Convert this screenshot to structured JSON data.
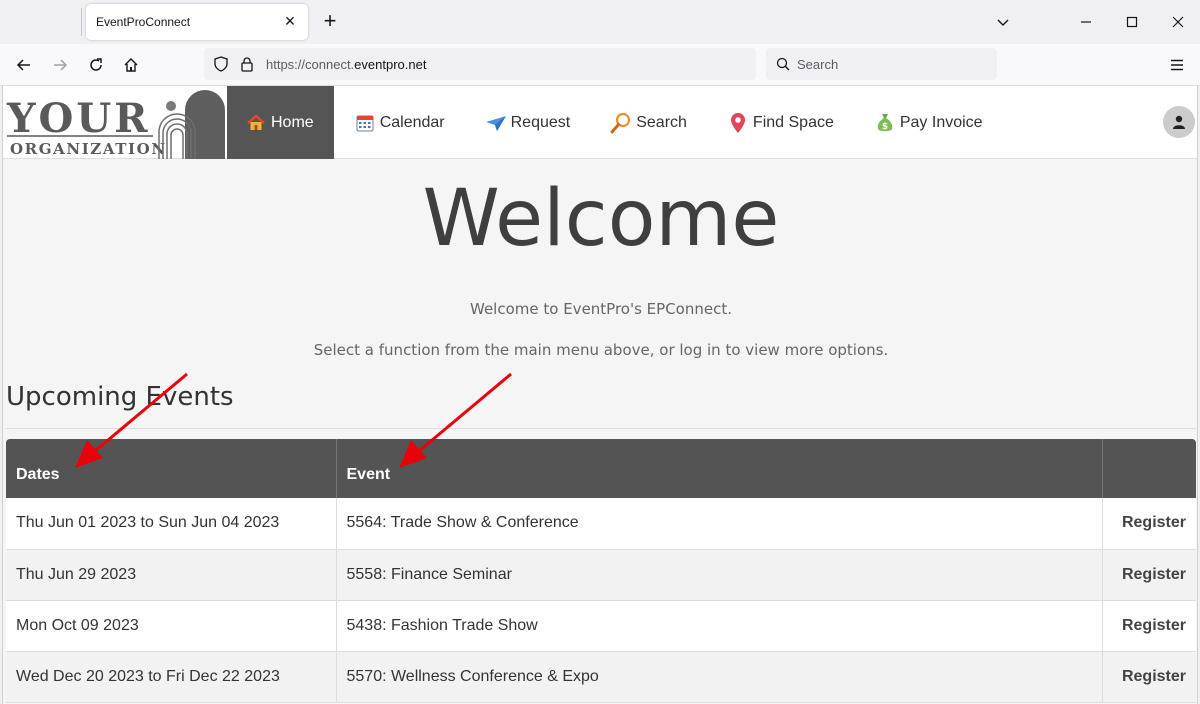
{
  "browser": {
    "tab_title": "EventProConnect",
    "url_prefix": "https://connect.",
    "url_host": "eventpro.net",
    "search_placeholder": "Search"
  },
  "menu": {
    "items": [
      {
        "label": "Home",
        "icon": "house-icon"
      },
      {
        "label": "Calendar",
        "icon": "calendar-icon"
      },
      {
        "label": "Request",
        "icon": "paper-plane-icon"
      },
      {
        "label": "Search",
        "icon": "magnifier-icon"
      },
      {
        "label": "Find Space",
        "icon": "map-pin-icon"
      },
      {
        "label": "Pay Invoice",
        "icon": "money-bag-icon"
      }
    ],
    "active": "Home"
  },
  "logo": {
    "line1": "YOUR",
    "line2": "ORGANIZATION"
  },
  "welcome": {
    "title": "Welcome",
    "line1": "Welcome to EventPro's EPConnect.",
    "line2": "Select a function from the main menu above, or log in to view more options."
  },
  "events": {
    "heading": "Upcoming Events",
    "columns": [
      "Dates",
      "Event",
      ""
    ],
    "rows": [
      {
        "dates": "Thu Jun 01 2023 to Sun Jun 04 2023",
        "event": "5564: Trade Show & Conference",
        "action": "Register"
      },
      {
        "dates": "Thu Jun 29 2023",
        "event": "5558: Finance Seminar",
        "action": "Register"
      },
      {
        "dates": "Mon Oct 09 2023",
        "event": "5438: Fashion Trade Show",
        "action": "Register"
      },
      {
        "dates": "Wed Dec 20 2023 to Fri Dec 22 2023",
        "event": "5570: Wellness Conference & Expo",
        "action": "Register"
      }
    ]
  },
  "colors": {
    "header_bg": "#545454",
    "active_menu_bg": "#555555",
    "annotation_arrow": "#e8000b"
  }
}
